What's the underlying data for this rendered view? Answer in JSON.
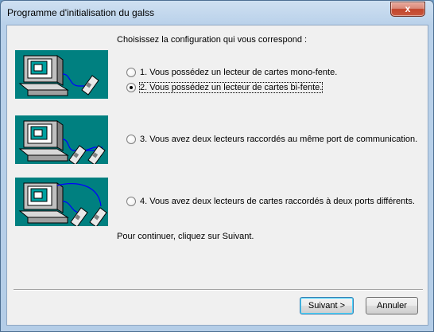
{
  "window": {
    "title": "Programme d'initialisation du galss",
    "close_glyph": "x"
  },
  "prompt": "Choisissez la configuration qui vous correspond :",
  "options": [
    {
      "label": "1. Vous possédez un lecteur de cartes mono-fente.",
      "checked": false
    },
    {
      "label": "2. Vous possédez un lecteur de cartes bi-fente.",
      "checked": true
    },
    {
      "label": "3. Vous avez deux lecteurs raccordés au même port de communication.",
      "checked": false
    },
    {
      "label": "4. Vous avez deux lecteurs de cartes raccordés à deux ports différents.",
      "checked": false
    }
  ],
  "continue_text": "Pour continuer, cliquez sur Suivant.",
  "buttons": {
    "next": "Suivant >",
    "cancel": "Annuler"
  },
  "colors": {
    "illustration_bg": "#008080",
    "cable": "#0000ff",
    "default_button_border": "#3c7fb1"
  }
}
